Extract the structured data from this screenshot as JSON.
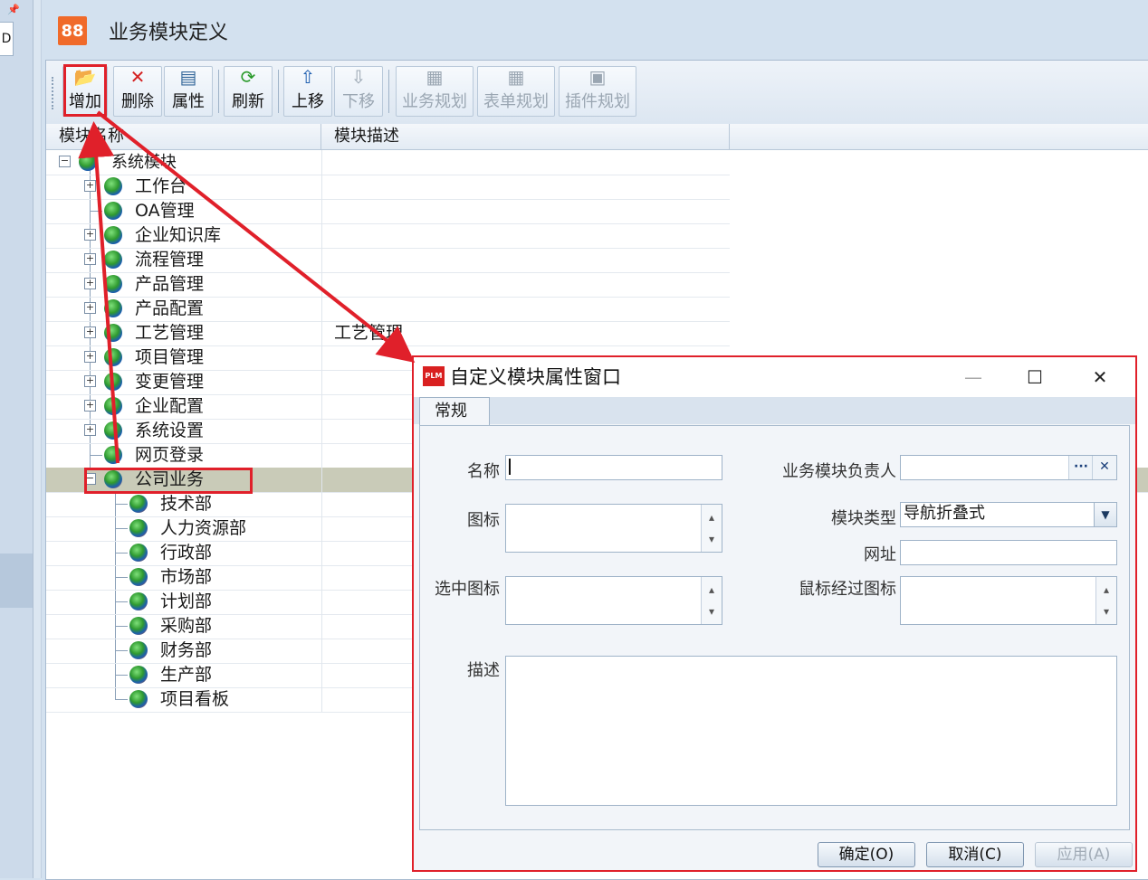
{
  "page_title": "业务模块定义",
  "app_icon_glyph": "88",
  "toolbar": {
    "add": "增加",
    "delete": "删除",
    "properties": "属性",
    "refresh": "刷新",
    "move_up": "上移",
    "move_down": "下移",
    "business_plan": "业务规划",
    "form_plan": "表单规划",
    "plugin_plan": "插件规划"
  },
  "columns": {
    "name": "模块名称",
    "desc": "模块描述"
  },
  "tree": {
    "root": "系统模块",
    "items": [
      {
        "label": "工作台",
        "desc": ""
      },
      {
        "label": "OA管理",
        "desc": ""
      },
      {
        "label": "企业知识库",
        "desc": ""
      },
      {
        "label": "流程管理",
        "desc": ""
      },
      {
        "label": "产品管理",
        "desc": ""
      },
      {
        "label": "产品配置",
        "desc": ""
      },
      {
        "label": "工艺管理",
        "desc": "工艺管理"
      },
      {
        "label": "项目管理",
        "desc": ""
      },
      {
        "label": "变更管理",
        "desc": ""
      },
      {
        "label": "企业配置",
        "desc": ""
      },
      {
        "label": "系统设置",
        "desc": ""
      },
      {
        "label": "网页登录",
        "desc": ""
      },
      {
        "label": "公司业务",
        "desc": ""
      }
    ],
    "children": [
      "技术部",
      "人力资源部",
      "行政部",
      "市场部",
      "计划部",
      "采购部",
      "财务部",
      "生产部",
      "项目看板"
    ]
  },
  "dialog": {
    "title": "自定义模块属性窗口",
    "icon_text": "PLM",
    "tab": "常规",
    "labels": {
      "name": "名称",
      "icon": "图标",
      "selected_icon": "选中图标",
      "desc": "描述",
      "owner": "业务模块负责人",
      "type": "模块类型",
      "url": "网址",
      "hover_icon": "鼠标经过图标"
    },
    "type_value": "导航折叠式",
    "buttons": {
      "ok": "确定(O)",
      "cancel": "取消(C)",
      "apply": "应用(A)"
    }
  },
  "colors": {
    "annotation": "#e0202a",
    "accent": "#f06a2a"
  }
}
